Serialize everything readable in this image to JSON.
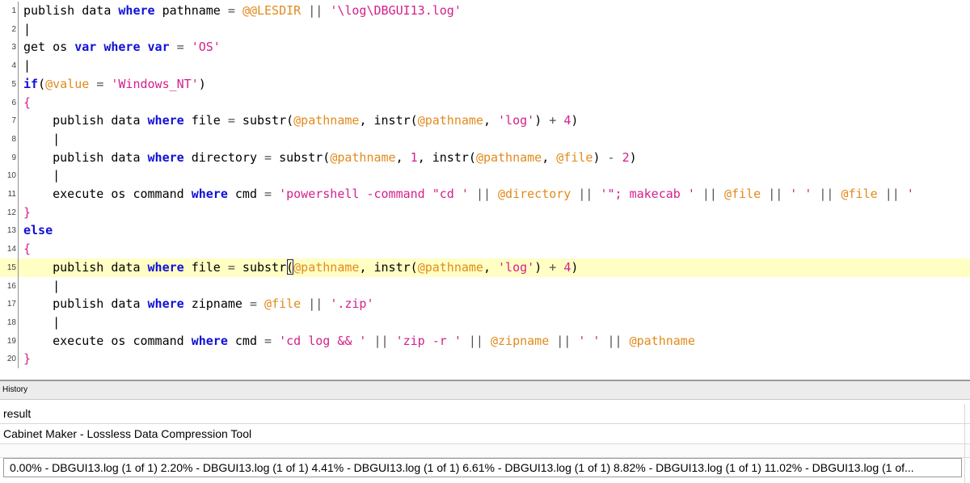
{
  "editor": {
    "current_line": 15,
    "lines": [
      {
        "n": "1",
        "tokens": [
          [
            "kw0",
            "publish data "
          ],
          [
            "kw",
            "where"
          ],
          [
            "t",
            " pathname "
          ],
          [
            "op",
            "="
          ],
          [
            "t",
            " "
          ],
          [
            "var",
            "@@LESDIR"
          ],
          [
            "t",
            " "
          ],
          [
            "op",
            "||"
          ],
          [
            "t",
            " "
          ],
          [
            "str",
            "'\\log\\DBGUI13.log'"
          ]
        ]
      },
      {
        "n": "2",
        "tokens": [
          [
            "t",
            "|"
          ]
        ]
      },
      {
        "n": "3",
        "tokens": [
          [
            "t",
            "get os "
          ],
          [
            "kw",
            "var where var"
          ],
          [
            "t",
            " "
          ],
          [
            "op",
            "="
          ],
          [
            "t",
            " "
          ],
          [
            "str",
            "'OS'"
          ]
        ]
      },
      {
        "n": "4",
        "tokens": [
          [
            "t",
            "|"
          ]
        ]
      },
      {
        "n": "5",
        "tokens": [
          [
            "kw",
            "if"
          ],
          [
            "t",
            "("
          ],
          [
            "var",
            "@value"
          ],
          [
            "t",
            " "
          ],
          [
            "op",
            "="
          ],
          [
            "t",
            " "
          ],
          [
            "str",
            "'Windows_NT'"
          ],
          [
            "t",
            ")"
          ]
        ]
      },
      {
        "n": "6",
        "tokens": [
          [
            "str",
            "{"
          ]
        ]
      },
      {
        "n": "7",
        "tokens": [
          [
            "t",
            "    publish data "
          ],
          [
            "kw",
            "where"
          ],
          [
            "t",
            " file "
          ],
          [
            "op",
            "="
          ],
          [
            "t",
            " substr("
          ],
          [
            "var",
            "@pathname"
          ],
          [
            "t",
            ", instr("
          ],
          [
            "var",
            "@pathname"
          ],
          [
            "t",
            ", "
          ],
          [
            "str",
            "'log'"
          ],
          [
            "t",
            ") "
          ],
          [
            "op",
            "+"
          ],
          [
            "t",
            " "
          ],
          [
            "num",
            "4"
          ],
          [
            "t",
            ")"
          ]
        ]
      },
      {
        "n": "8",
        "tokens": [
          [
            "t",
            "    |"
          ]
        ]
      },
      {
        "n": "9",
        "tokens": [
          [
            "t",
            "    publish data "
          ],
          [
            "kw",
            "where"
          ],
          [
            "t",
            " directory "
          ],
          [
            "op",
            "="
          ],
          [
            "t",
            " substr("
          ],
          [
            "var",
            "@pathname"
          ],
          [
            "t",
            ", "
          ],
          [
            "num",
            "1"
          ],
          [
            "t",
            ", instr("
          ],
          [
            "var",
            "@pathname"
          ],
          [
            "t",
            ", "
          ],
          [
            "var",
            "@file"
          ],
          [
            "t",
            ") "
          ],
          [
            "op",
            "-"
          ],
          [
            "t",
            " "
          ],
          [
            "num",
            "2"
          ],
          [
            "t",
            ")"
          ]
        ]
      },
      {
        "n": "10",
        "tokens": [
          [
            "t",
            "    |"
          ]
        ]
      },
      {
        "n": "11",
        "tokens": [
          [
            "t",
            "    execute os command "
          ],
          [
            "kw",
            "where"
          ],
          [
            "t",
            " cmd "
          ],
          [
            "op",
            "="
          ],
          [
            "t",
            " "
          ],
          [
            "str",
            "'powershell -command \"cd '"
          ],
          [
            "t",
            " "
          ],
          [
            "op",
            "||"
          ],
          [
            "t",
            " "
          ],
          [
            "var",
            "@directory"
          ],
          [
            "t",
            " "
          ],
          [
            "op",
            "||"
          ],
          [
            "t",
            " "
          ],
          [
            "str",
            "'\"; makecab '"
          ],
          [
            "t",
            " "
          ],
          [
            "op",
            "||"
          ],
          [
            "t",
            " "
          ],
          [
            "var",
            "@file"
          ],
          [
            "t",
            " "
          ],
          [
            "op",
            "||"
          ],
          [
            "t",
            " "
          ],
          [
            "str",
            "' '"
          ],
          [
            "t",
            " "
          ],
          [
            "op",
            "||"
          ],
          [
            "t",
            " "
          ],
          [
            "var",
            "@file"
          ],
          [
            "t",
            " "
          ],
          [
            "op",
            "||"
          ],
          [
            "t",
            " "
          ],
          [
            "str",
            "'"
          ]
        ]
      },
      {
        "n": "12",
        "tokens": [
          [
            "str",
            "}"
          ]
        ]
      },
      {
        "n": "13",
        "tokens": [
          [
            "kw",
            "else"
          ]
        ]
      },
      {
        "n": "14",
        "tokens": [
          [
            "str",
            "{"
          ]
        ]
      },
      {
        "n": "15",
        "tokens": [
          [
            "t",
            "    publish data "
          ],
          [
            "kw",
            "where"
          ],
          [
            "t",
            " file "
          ],
          [
            "op",
            "="
          ],
          [
            "t",
            " substr"
          ],
          [
            "caret",
            "("
          ],
          [
            "var",
            "@pathname"
          ],
          [
            "t",
            ", instr("
          ],
          [
            "var",
            "@pathname"
          ],
          [
            "t",
            ", "
          ],
          [
            "str",
            "'log'"
          ],
          [
            "t",
            ") "
          ],
          [
            "op",
            "+"
          ],
          [
            "t",
            " "
          ],
          [
            "num",
            "4"
          ],
          [
            "t",
            ")"
          ]
        ]
      },
      {
        "n": "16",
        "tokens": [
          [
            "t",
            "    |"
          ]
        ]
      },
      {
        "n": "17",
        "tokens": [
          [
            "t",
            "    publish data "
          ],
          [
            "kw",
            "where"
          ],
          [
            "t",
            " zipname "
          ],
          [
            "op",
            "="
          ],
          [
            "t",
            " "
          ],
          [
            "var",
            "@file"
          ],
          [
            "t",
            " "
          ],
          [
            "op",
            "||"
          ],
          [
            "t",
            " "
          ],
          [
            "str",
            "'.zip'"
          ]
        ]
      },
      {
        "n": "18",
        "tokens": [
          [
            "t",
            "    |"
          ]
        ]
      },
      {
        "n": "19",
        "tokens": [
          [
            "t",
            "    execute os command "
          ],
          [
            "kw",
            "where"
          ],
          [
            "t",
            " cmd "
          ],
          [
            "op",
            "="
          ],
          [
            "t",
            " "
          ],
          [
            "str",
            "'cd log && '"
          ],
          [
            "t",
            " "
          ],
          [
            "op",
            "||"
          ],
          [
            "t",
            " "
          ],
          [
            "str",
            "'zip -r '"
          ],
          [
            "t",
            " "
          ],
          [
            "op",
            "||"
          ],
          [
            "t",
            " "
          ],
          [
            "var",
            "@zipname"
          ],
          [
            "t",
            " "
          ],
          [
            "op",
            "||"
          ],
          [
            "t",
            " "
          ],
          [
            "str",
            "' '"
          ],
          [
            "t",
            " "
          ],
          [
            "op",
            "||"
          ],
          [
            "t",
            " "
          ],
          [
            "var",
            "@pathname"
          ]
        ]
      },
      {
        "n": "20",
        "tokens": [
          [
            "str",
            "}"
          ]
        ]
      }
    ]
  },
  "history": {
    "label": "History"
  },
  "results": {
    "column_header": "result",
    "rows": [
      "Cabinet Maker - Lossless Data Compression Tool",
      "0.00% - DBGUI13.log (1 of 1)  2.20% - DBGUI13.log (1 of 1)  4.41% - DBGUI13.log (1 of 1)  6.61% - DBGUI13.log (1 of 1)  8.82% - DBGUI13.log (1 of 1)  11.02% - DBGUI13.log (1 of..."
    ]
  },
  "colors": {
    "keyword": "#1010d8",
    "string": "#d4208c",
    "variable": "#e28a1c",
    "current_line_bg": "#ffffc4"
  }
}
